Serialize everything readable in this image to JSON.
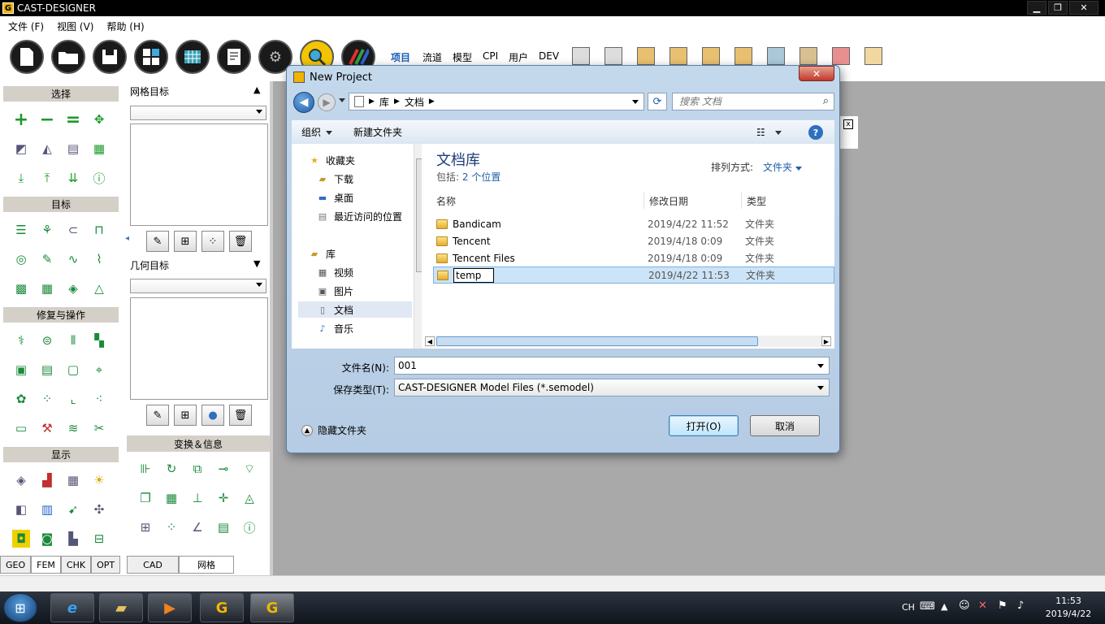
{
  "app": {
    "title": "CAST-DESIGNER",
    "logo_letter": "G",
    "win_min": "▁",
    "win_max": "❐",
    "win_close": "✕"
  },
  "menu": [
    {
      "label": "文件 (F)"
    },
    {
      "label": "视图 (V)"
    },
    {
      "label": "帮助 (H)"
    }
  ],
  "toolbar": {
    "round_icons": [
      "new-file-icon",
      "open-folder-icon",
      "save-icon",
      "modules-icon",
      "mesh-icon",
      "report-icon",
      "gear-icon",
      "search-icon",
      "tools-icon"
    ],
    "tabs": [
      "项目",
      "流道",
      "模型",
      "CPI",
      "用户",
      "DEV"
    ],
    "active_tab": "项目"
  },
  "left": {
    "groups": [
      "选择",
      "目标",
      "修复与操作",
      "显示"
    ],
    "mesh_target_label": "网格目标",
    "geo_target_label": "几何目标",
    "transform_label": "变换＆信息",
    "bottom_tabs_left": [
      "GEO",
      "FEM",
      "CHK",
      "OPT"
    ],
    "bottom_tabs_right": [
      "CAD",
      "网格"
    ],
    "active_bottom_tab": "FEM"
  },
  "dialog": {
    "title": "New Project",
    "close_label": "✕",
    "breadcrumb": [
      "库",
      "文档"
    ],
    "search_placeholder": "搜索 文档",
    "organize": "组织",
    "new_folder": "新建文件夹",
    "view_label": "☷",
    "help_label": "?",
    "nav": {
      "favorites": "收藏夹",
      "downloads": "下载",
      "desktop": "桌面",
      "recent": "最近访问的位置",
      "libraries": "库",
      "videos": "视频",
      "pictures": "图片",
      "documents": "文档",
      "music": "音乐"
    },
    "library_title": "文档库",
    "library_includes": "包括:",
    "library_locations": "2 个位置",
    "sort_label": "排列方式:",
    "sort_value": "文件夹",
    "columns": [
      "名称",
      "修改日期",
      "类型"
    ],
    "files": [
      {
        "name": "Bandicam",
        "date": "2019/4/22 11:52",
        "type": "文件夹"
      },
      {
        "name": "Tencent",
        "date": "2019/4/18 0:09",
        "type": "文件夹"
      },
      {
        "name": "Tencent Files",
        "date": "2019/4/18 0:09",
        "type": "文件夹"
      },
      {
        "name": "temp",
        "date": "2019/4/22 11:53",
        "type": "文件夹"
      }
    ],
    "filename_label": "文件名(N):",
    "filename_value": "001",
    "filetype_label": "保存类型(T):",
    "filetype_value": "CAST-DESIGNER Model Files (*.semodel)",
    "hide_folders": "隐藏文件夹",
    "open_button": "打开(O)",
    "cancel_button": "取消"
  },
  "taskbar": {
    "lang": "CH",
    "time": "11:53",
    "date": "2019/4/22"
  },
  "colors": {
    "accent_blue": "#1f5fa8",
    "titlebar": "#000000",
    "selection": "#cce4f7"
  }
}
